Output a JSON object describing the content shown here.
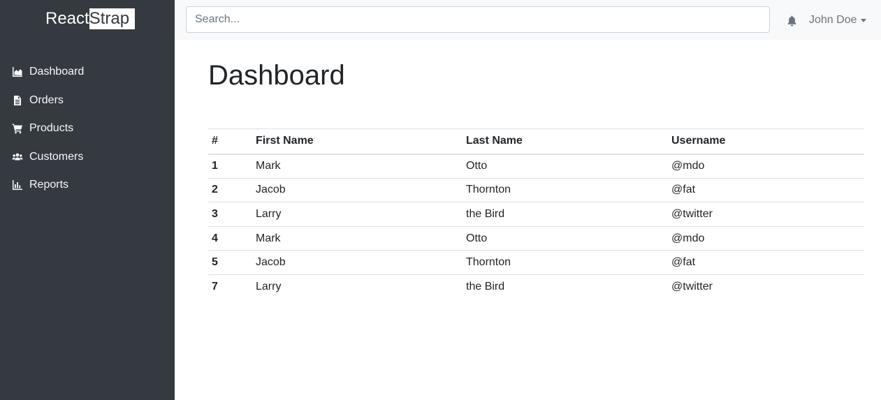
{
  "brand": {
    "part1": "React",
    "part2": "Strap"
  },
  "sidebar": {
    "items": [
      {
        "label": "Dashboard",
        "icon": "chart-area-icon"
      },
      {
        "label": "Orders",
        "icon": "file-icon"
      },
      {
        "label": "Products",
        "icon": "shopping-cart-icon"
      },
      {
        "label": "Customers",
        "icon": "users-icon"
      },
      {
        "label": "Reports",
        "icon": "bar-chart-icon"
      }
    ]
  },
  "header": {
    "search_placeholder": "Search...",
    "user_name": "John Doe",
    "notification_icon": "bell-icon"
  },
  "main": {
    "title": "Dashboard",
    "table": {
      "columns": [
        "#",
        "First Name",
        "Last Name",
        "Username"
      ],
      "rows": [
        [
          "1",
          "Mark",
          "Otto",
          "@mdo"
        ],
        [
          "2",
          "Jacob",
          "Thornton",
          "@fat"
        ],
        [
          "3",
          "Larry",
          "the Bird",
          "@twitter"
        ],
        [
          "4",
          "Mark",
          "Otto",
          "@mdo"
        ],
        [
          "5",
          "Jacob",
          "Thornton",
          "@fat"
        ],
        [
          "7",
          "Larry",
          "the Bird",
          "@twitter"
        ]
      ]
    }
  },
  "colors": {
    "sidebar_bg": "#343a40",
    "topbar_bg": "#f8f9fa",
    "text": "#212529",
    "muted": "#6c757d"
  }
}
